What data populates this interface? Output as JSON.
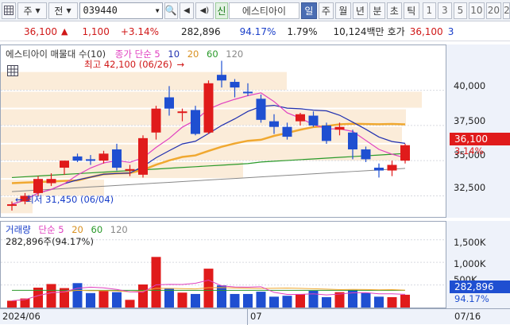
{
  "toolbar": {
    "market": "주",
    "type": "전",
    "code": "039440",
    "new_label": "신",
    "name": "에스티아이",
    "periods": [
      "일",
      "주",
      "월",
      "년",
      "분",
      "초",
      "틱"
    ],
    "numbers": [
      "1",
      "3",
      "5",
      "10",
      "20",
      "2"
    ]
  },
  "quote": {
    "price": "36,100",
    "change": "1,100",
    "change_pct": "+3.14%",
    "volume": "282,896",
    "vol_ratio": "94.17%",
    "turnover": "1.79%",
    "amount": "10,124백만",
    "bid_label": "호가",
    "bid_price": "36,100",
    "tail": "3"
  },
  "price_legend": {
    "name": "에스티아이 매물대 수(10)",
    "ma_label": "종가 단순 5",
    "ma10": "10",
    "ma20": "20",
    "ma60": "60",
    "ma120": "120"
  },
  "annotations": {
    "high": "최고 42,100 (06/26)",
    "low": "최저 31,450 (06/04)"
  },
  "price_axis": {
    "ticks": [
      "40,000",
      "37,500",
      "35,000",
      "32,500"
    ],
    "current": "36,100",
    "current_pct": "3.14%"
  },
  "volume_legend": {
    "name": "거래량",
    "ma_label": "단순 5",
    "ma20": "20",
    "ma60": "60",
    "ma120": "120",
    "value_line": "282,896주(94.17%)"
  },
  "volume_axis": {
    "ticks": [
      "1,500K",
      "1,000K",
      "500K"
    ],
    "current": "282,896",
    "current_pct": "94.17%"
  },
  "date_axis": {
    "labels": [
      "2024/06",
      "07",
      "07/16"
    ]
  },
  "colors": {
    "up": "#e01b1b",
    "down": "#1f4fd1",
    "ma5": "#e040c0",
    "ma10": "#2030b0",
    "ma20": "#f0a830",
    "ma60": "#2a9a2a",
    "ma120": "#888888"
  },
  "chart_data": {
    "type": "candlestick",
    "price_range": [
      31000,
      43200
    ],
    "volume_range": [
      0,
      1900000
    ],
    "candles": [
      {
        "o": 31800,
        "h": 32100,
        "l": 31450,
        "c": 31900,
        "v": 150000
      },
      {
        "o": 32100,
        "h": 32700,
        "l": 31900,
        "c": 32500,
        "v": 200000
      },
      {
        "o": 32700,
        "h": 33900,
        "l": 32500,
        "c": 33700,
        "v": 440000
      },
      {
        "o": 33400,
        "h": 34100,
        "l": 33200,
        "c": 33700,
        "v": 520000
      },
      {
        "o": 34500,
        "h": 35000,
        "l": 34000,
        "c": 35000,
        "v": 430000
      },
      {
        "o": 35300,
        "h": 35500,
        "l": 34900,
        "c": 35000,
        "v": 540000
      },
      {
        "o": 35100,
        "h": 35400,
        "l": 34700,
        "c": 35000,
        "v": 320000
      },
      {
        "o": 35000,
        "h": 35700,
        "l": 34800,
        "c": 35500,
        "v": 370000
      },
      {
        "o": 35800,
        "h": 36200,
        "l": 34300,
        "c": 34500,
        "v": 340000
      },
      {
        "o": 34300,
        "h": 34700,
        "l": 33900,
        "c": 34400,
        "v": 170000
      },
      {
        "o": 34000,
        "h": 36800,
        "l": 33800,
        "c": 36600,
        "v": 510000
      },
      {
        "o": 37000,
        "h": 38900,
        "l": 36500,
        "c": 38700,
        "v": 1120000
      },
      {
        "o": 39500,
        "h": 40300,
        "l": 38200,
        "c": 38700,
        "v": 420000
      },
      {
        "o": 38400,
        "h": 38700,
        "l": 37800,
        "c": 38500,
        "v": 330000
      },
      {
        "o": 38600,
        "h": 38900,
        "l": 36800,
        "c": 36900,
        "v": 300000
      },
      {
        "o": 37000,
        "h": 40700,
        "l": 36900,
        "c": 40500,
        "v": 860000
      },
      {
        "o": 41100,
        "h": 42100,
        "l": 40200,
        "c": 40700,
        "v": 490000
      },
      {
        "o": 40600,
        "h": 40800,
        "l": 39500,
        "c": 40200,
        "v": 300000
      },
      {
        "o": 39900,
        "h": 40500,
        "l": 39600,
        "c": 39800,
        "v": 300000
      },
      {
        "o": 39400,
        "h": 39700,
        "l": 37700,
        "c": 37900,
        "v": 350000
      },
      {
        "o": 37800,
        "h": 38300,
        "l": 36900,
        "c": 37400,
        "v": 240000
      },
      {
        "o": 37400,
        "h": 37700,
        "l": 36500,
        "c": 36700,
        "v": 260000
      },
      {
        "o": 37800,
        "h": 38400,
        "l": 37500,
        "c": 38300,
        "v": 300000
      },
      {
        "o": 38200,
        "h": 38500,
        "l": 37400,
        "c": 37500,
        "v": 370000
      },
      {
        "o": 37500,
        "h": 37700,
        "l": 36200,
        "c": 36400,
        "v": 230000
      },
      {
        "o": 37200,
        "h": 37700,
        "l": 36800,
        "c": 37400,
        "v": 340000
      },
      {
        "o": 37000,
        "h": 37200,
        "l": 35100,
        "c": 35800,
        "v": 390000
      },
      {
        "o": 35800,
        "h": 36000,
        "l": 34900,
        "c": 35100,
        "v": 320000
      },
      {
        "o": 34500,
        "h": 34800,
        "l": 33800,
        "c": 34300,
        "v": 240000
      },
      {
        "o": 34300,
        "h": 35000,
        "l": 33900,
        "c": 34700,
        "v": 230000
      },
      {
        "o": 35000,
        "h": 36200,
        "l": 34800,
        "c": 36100,
        "v": 282896
      }
    ]
  }
}
